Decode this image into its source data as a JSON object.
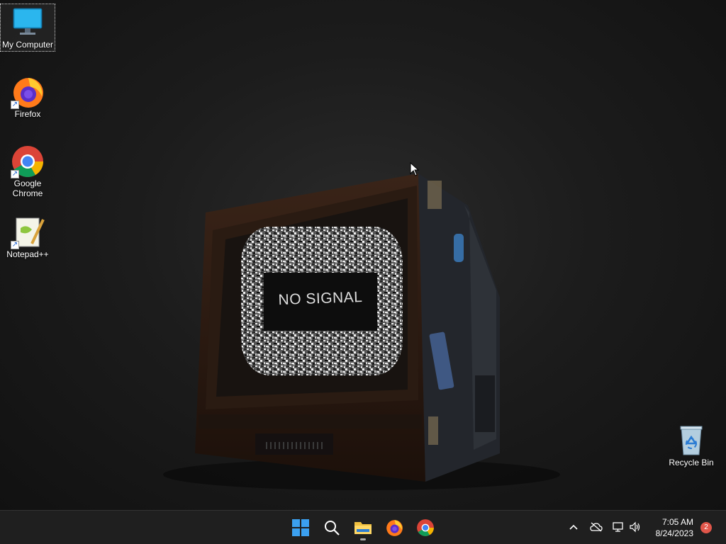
{
  "desktop": {
    "icons": [
      {
        "label": "My Computer"
      },
      {
        "label": "Firefox"
      },
      {
        "label": "Google Chrome"
      },
      {
        "label": "Notepad++"
      },
      {
        "label": "Recycle Bin"
      }
    ],
    "wallpaper": {
      "screen_text": "NO SIGNAL"
    }
  },
  "taskbar": {
    "apps": [
      {
        "name": "start-button",
        "icon": "windows-logo-icon"
      },
      {
        "name": "search-button",
        "icon": "search-icon"
      },
      {
        "name": "file-explorer-button",
        "icon": "folder-icon",
        "active": true
      },
      {
        "name": "firefox-taskbar-button",
        "icon": "firefox-icon"
      },
      {
        "name": "chrome-taskbar-button",
        "icon": "chrome-icon"
      }
    ],
    "tray": {
      "icons": [
        "chevron-up-icon",
        "cloud-offline-icon",
        "network-icon",
        "volume-icon"
      ],
      "time": "7:05 AM",
      "date": "8/24/2023",
      "notification_count": "2"
    }
  },
  "colors": {
    "accent": "#0078d4",
    "taskbar": "#1f1f1f",
    "badge": "#e0564a"
  }
}
